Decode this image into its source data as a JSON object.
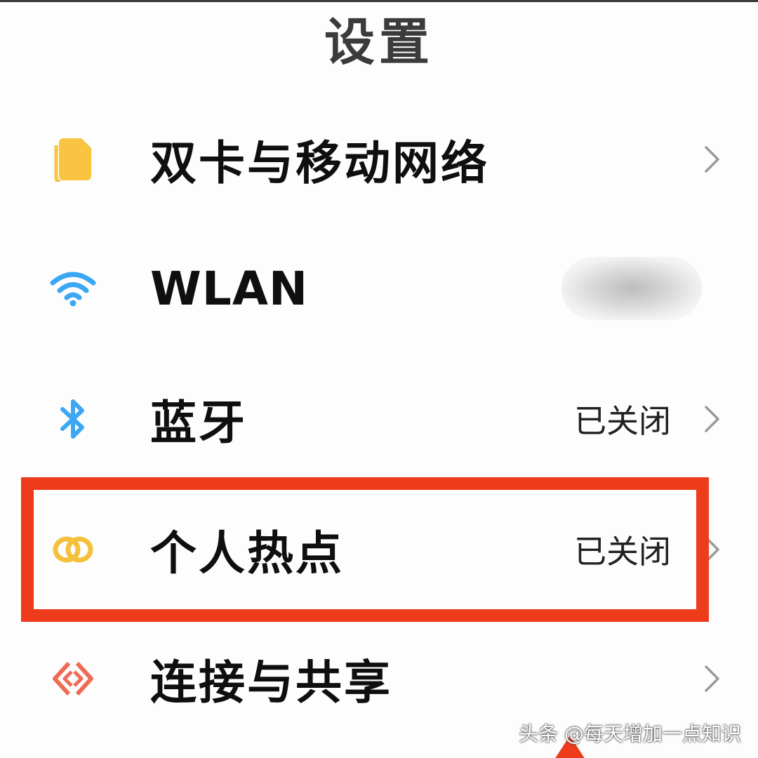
{
  "page": {
    "title": "设置"
  },
  "settings": {
    "items": [
      {
        "label": "双卡与移动网络",
        "status": "",
        "icon": "sim-card-icon",
        "icon_color": "#F8C441"
      },
      {
        "label": "WLAN",
        "status": "",
        "icon": "wifi-icon",
        "icon_color": "#3BA7F2"
      },
      {
        "label": "蓝牙",
        "status": "已关闭",
        "icon": "bluetooth-icon",
        "icon_color": "#3BA7F2"
      },
      {
        "label": "个人热点",
        "status": "已关闭",
        "icon": "hotspot-icon",
        "icon_color": "#F5C03A"
      },
      {
        "label": "连接与共享",
        "status": "",
        "icon": "connection-sharing-icon",
        "icon_color": "#EF6A55"
      }
    ]
  },
  "annotation": {
    "highlight_color": "#EE3B1C"
  },
  "watermark": {
    "text": "头条 @每天增加一点知识"
  }
}
